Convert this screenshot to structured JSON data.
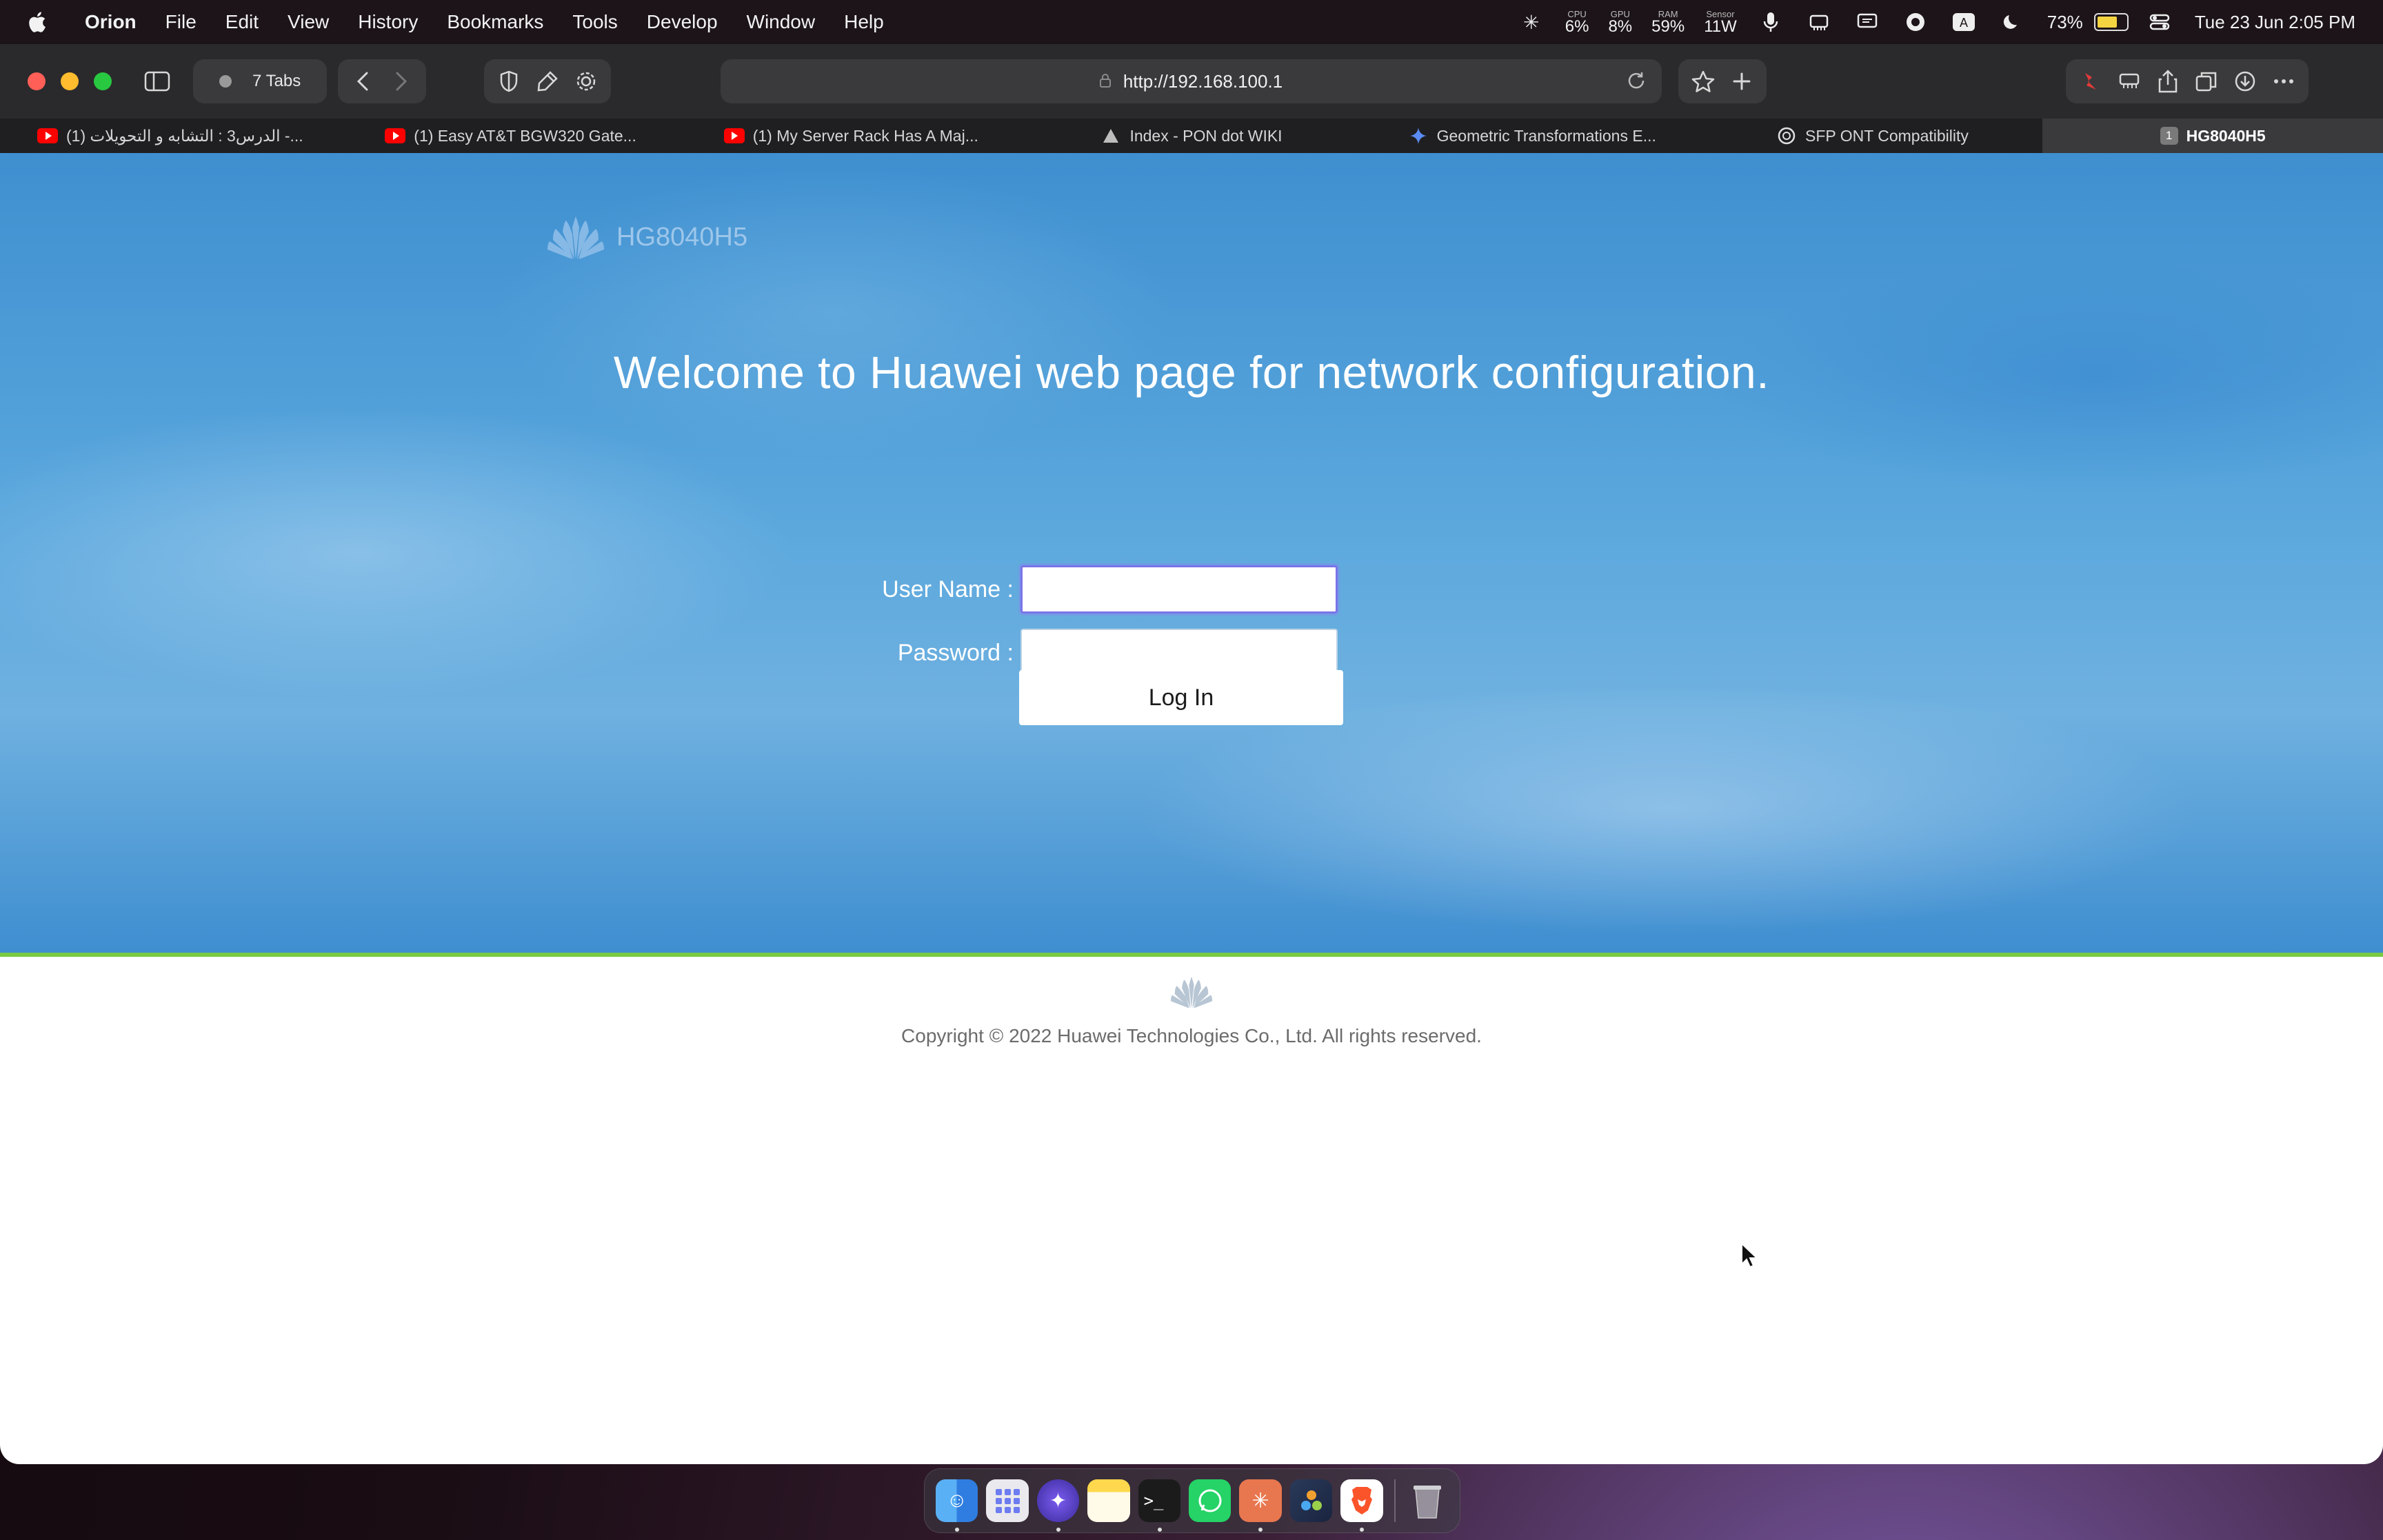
{
  "menubar": {
    "app": "Orion",
    "menus": [
      "File",
      "Edit",
      "View",
      "History",
      "Bookmarks",
      "Tools",
      "Develop",
      "Window",
      "Help"
    ],
    "stats": [
      {
        "label": "CPU",
        "value": "6%"
      },
      {
        "label": "GPU",
        "value": "8%"
      },
      {
        "label": "RAM",
        "value": "59%"
      },
      {
        "label": "Sensor",
        "value": "11W"
      }
    ],
    "battery_percent": "73%",
    "battery_level": 0.73,
    "datetime": "Tue 23 Jun  2:05 PM"
  },
  "toolbar": {
    "tabs_count": "7 Tabs",
    "url": "http://192.168.100.1"
  },
  "tabs": [
    {
      "title": "(1) الدرس3 : التشابه و التحويلات -...",
      "favicon": "youtube"
    },
    {
      "title": "(1) Easy AT&T BGW320 Gate...",
      "favicon": "youtube"
    },
    {
      "title": "(1) My Server Rack Has A Maj...",
      "favicon": "youtube"
    },
    {
      "title": "Index - PON dot WIKI",
      "favicon": "wiki-triangle"
    },
    {
      "title": "Geometric Transformations E...",
      "favicon": "gemini-star"
    },
    {
      "title": "SFP ONT Compatibility",
      "favicon": "openai"
    },
    {
      "title": "HG8040H5",
      "favicon": "page-1",
      "active": true,
      "badge": "1"
    }
  ],
  "page": {
    "model": "HG8040H5",
    "welcome": "Welcome to Huawei web page for network configuration.",
    "username_label": "User Name :",
    "password_label": "Password :",
    "username_value": "",
    "password_value": "",
    "login_label": "Log In",
    "copyright": "Copyright © 2022 Huawei Technologies Co., Ltd. All rights reserved."
  },
  "colors": {
    "hero_blue": "#4a9ad8",
    "accent_green": "#7ac943",
    "focus_ring": "#7a74e8"
  },
  "dock": [
    "finder",
    "launchpad",
    "safari-like-compass",
    "notes",
    "terminal",
    "whatsapp",
    "claude",
    "davinci-resolve",
    "brave",
    "trash"
  ]
}
